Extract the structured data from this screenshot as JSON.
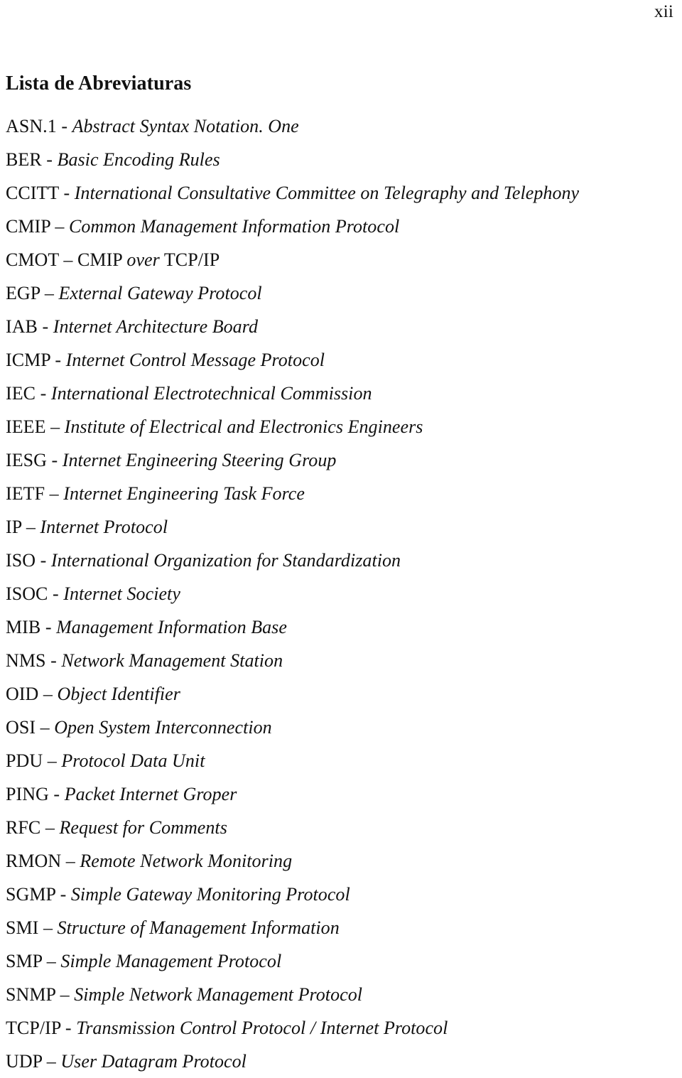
{
  "page": {
    "folio": "xii",
    "background_color": "#ffffff",
    "text_color": "#111111"
  },
  "section": {
    "title": "Lista de Abreviaturas"
  },
  "abbreviations": [
    {
      "term": "ASN.1",
      "separator": " - ",
      "definition": "Abstract Syntax Notation. One"
    },
    {
      "term": "BER",
      "separator": " - ",
      "definition": "Basic Encoding Rules"
    },
    {
      "term": "CCITT",
      "separator": " - ",
      "definition": "International Consultative Committee on Telegraphy and Telephony"
    },
    {
      "term": "CMIP",
      "separator": " – ",
      "definition": "Common Management Information Protocol"
    },
    {
      "term": "CMOT",
      "separator": " – ",
      "definition": "CMIP over TCP/IP",
      "definition_parts": [
        {
          "text": "CMIP ",
          "style": "upright"
        },
        {
          "text": "over",
          "style": "italic"
        },
        {
          "text": " TCP/IP",
          "style": "upright"
        }
      ]
    },
    {
      "term": "EGP",
      "separator": " – ",
      "definition": "External Gateway Protocol"
    },
    {
      "term": "IAB",
      "separator": " - ",
      "definition": "Internet Architecture Board"
    },
    {
      "term": "ICMP",
      "separator": " - ",
      "definition": "Internet Control Message Protocol"
    },
    {
      "term": "IEC",
      "separator": " - ",
      "definition": "International Electrotechnical Commission"
    },
    {
      "term": "IEEE",
      "separator": " – ",
      "definition": "Institute of Electrical and Electronics Engineers"
    },
    {
      "term": "IESG",
      "separator": " - ",
      "definition": "Internet Engineering Steering Group"
    },
    {
      "term": "IETF",
      "separator": " – ",
      "definition": "Internet Engineering Task Force"
    },
    {
      "term": "IP",
      "separator": " – ",
      "definition": "Internet Protocol"
    },
    {
      "term": "ISO",
      "separator": " - ",
      "definition": "International Organization for Standardization"
    },
    {
      "term": "ISOC",
      "separator": " - ",
      "definition": "Internet Society"
    },
    {
      "term": "MIB",
      "separator": " - ",
      "definition": "Management Information Base"
    },
    {
      "term": "NMS",
      "separator": " - ",
      "definition": "Network Management Station"
    },
    {
      "term": "OID",
      "separator": " – ",
      "definition": "Object Identifier"
    },
    {
      "term": "OSI",
      "separator": " – ",
      "definition": "Open System Interconnection"
    },
    {
      "term": "PDU",
      "separator": " – ",
      "definition": "Protocol Data Unit"
    },
    {
      "term": "PING",
      "separator": " - ",
      "definition": "Packet Internet Groper"
    },
    {
      "term": "RFC",
      "separator": " – ",
      "definition": "Request for Comments"
    },
    {
      "term": "RMON",
      "separator": " – ",
      "definition": "Remote Network Monitoring"
    },
    {
      "term": "SGMP",
      "separator": " - ",
      "definition": "Simple Gateway Monitoring Protocol"
    },
    {
      "term": "SMI",
      "separator": " – ",
      "definition": "Structure of Management Information"
    },
    {
      "term": "SMP",
      "separator": " – ",
      "definition": "Simple Management Protocol"
    },
    {
      "term": "SNMP",
      "separator": " – ",
      "definition": "Simple Network Management Protocol"
    },
    {
      "term": "TCP/IP",
      "separator": " - ",
      "definition": "Transmission Control Protocol / Internet Protocol"
    },
    {
      "term": "UDP",
      "separator": " – ",
      "definition": "User Datagram Protocol"
    }
  ]
}
